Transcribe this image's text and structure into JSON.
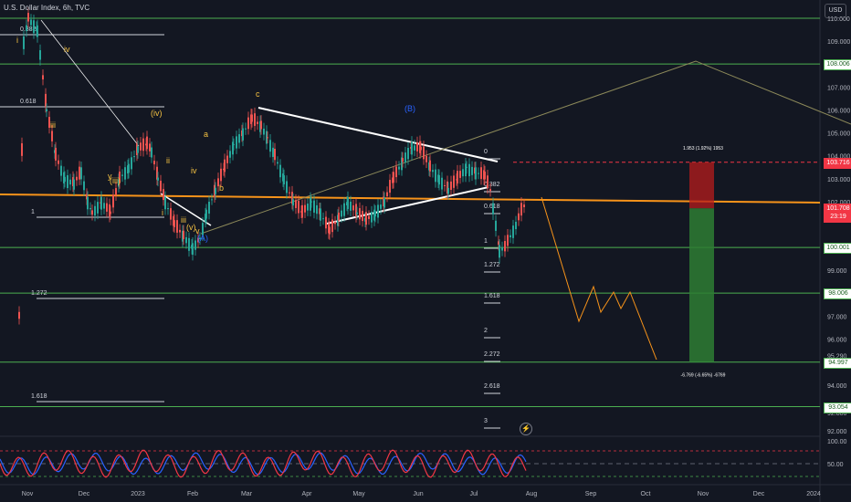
{
  "header": {
    "title": "U.S. Dollar Index, 6h, TVC",
    "currency_button": "USD"
  },
  "price_axis": {
    "ticks": [
      {
        "label": "110.000",
        "v": 110
      },
      {
        "label": "109.000",
        "v": 109
      },
      {
        "label": "107.000",
        "v": 107
      },
      {
        "label": "106.000",
        "v": 106
      },
      {
        "label": "105.000",
        "v": 105
      },
      {
        "label": "104.000",
        "v": 104
      },
      {
        "label": "103.000",
        "v": 103
      },
      {
        "label": "102.000",
        "v": 102
      },
      {
        "label": "99.000",
        "v": 99
      },
      {
        "label": "97.000",
        "v": 97
      },
      {
        "label": "96.000",
        "v": 96
      },
      {
        "label": "95.290",
        "v": 95.29
      },
      {
        "label": "94.000",
        "v": 94
      },
      {
        "label": "92.000",
        "v": 92
      },
      {
        "label": "92.800",
        "v": 92.8
      }
    ],
    "tags": [
      {
        "label": "108.006",
        "v": 108.006,
        "bg": "#ffffff",
        "fg": "#1b5e20",
        "border": "#4caf50"
      },
      {
        "label": "103.716",
        "v": 103.716,
        "bg": "#f23645",
        "fg": "#ffffff",
        "border": "#f23645"
      },
      {
        "label": "101.708",
        "v": 101.708,
        "bg": "#f23645",
        "fg": "#ffffff",
        "border": "#f23645"
      },
      {
        "label": "23:19",
        "v": 101.35,
        "bg": "#f23645",
        "fg": "#ffffff",
        "border": "#f23645"
      },
      {
        "label": "100.001",
        "v": 100.001,
        "bg": "#ffffff",
        "fg": "#1b5e20",
        "border": "#4caf50"
      },
      {
        "label": "98.006",
        "v": 98.006,
        "bg": "#ffffff",
        "fg": "#1b5e20",
        "border": "#4caf50"
      },
      {
        "label": "94.997",
        "v": 94.997,
        "bg": "#ffffff",
        "fg": "#1b5e20",
        "border": "#4caf50"
      },
      {
        "label": "93.054",
        "v": 93.054,
        "bg": "#ffffff",
        "fg": "#1b5e20",
        "border": "#4caf50"
      }
    ]
  },
  "oscillator_axis": [
    {
      "label": "100.00",
      "v": 100
    },
    {
      "label": "50.00",
      "v": 50
    }
  ],
  "time_axis": [
    "Nov",
    "Dec",
    "2023",
    "Feb",
    "Mar",
    "Apr",
    "May",
    "Jun",
    "Jul",
    "Aug",
    "Sep",
    "Oct",
    "Nov",
    "Dec",
    "2024"
  ],
  "fib_labels_left": [
    "0.382",
    "0.618",
    "1",
    "1.272",
    "1.618"
  ],
  "fib_labels_right": [
    "0",
    "0.382",
    "0.618",
    "1",
    "1.272",
    "1.618",
    "2",
    "2.272",
    "2.618",
    "3"
  ],
  "wave_labels": [
    "i",
    "iv",
    "iii",
    "y",
    "(iii)",
    "(iv)",
    "ii",
    "iv",
    "i",
    "iii",
    "(v)",
    "v",
    "(A)",
    "a",
    "b",
    "c",
    "(B)"
  ],
  "position": {
    "top_text": "1.953 (1.92%) 1953",
    "bottom_text": "-6.769 (-6.65%) -6769"
  },
  "colors": {
    "bg": "#131722",
    "green_line": "#4caf50",
    "orange_line": "#f7931a",
    "up": "#26a69a",
    "down": "#ef5350",
    "profit": "#2e7d32",
    "loss": "#b71c1c",
    "fib": "#ffffff",
    "wave_yellow": "#f5c242",
    "wave_blue": "#2962ff"
  }
}
